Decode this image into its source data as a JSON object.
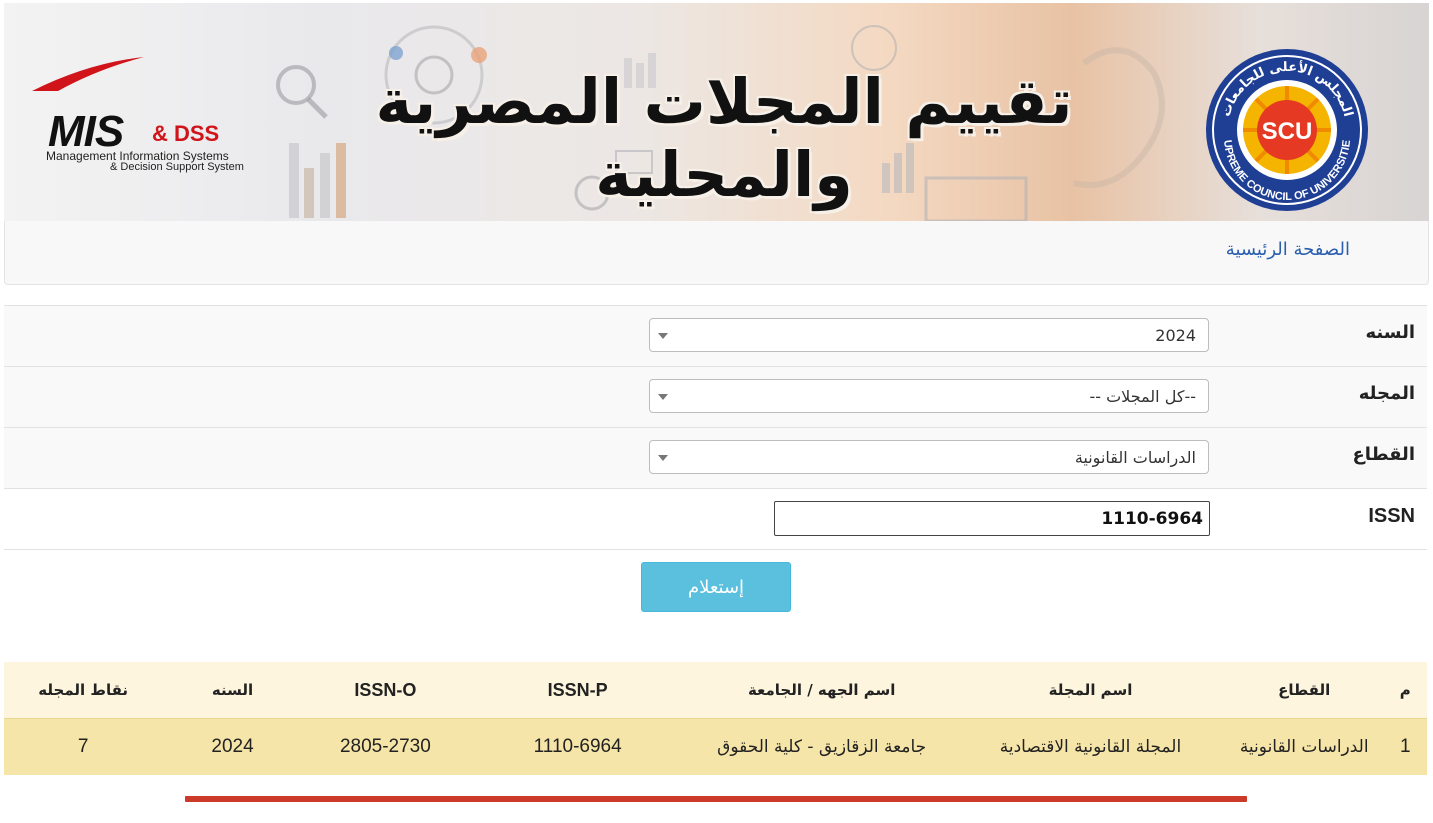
{
  "banner": {
    "title": "تقييم المجلات المصرية والمحلية",
    "left_logo": {
      "main": "MIS",
      "accent": "& DSS",
      "line1": "Management Information Systems",
      "line2": "& Decision Support System"
    },
    "right_logo": {
      "center": "SCU",
      "arc_top": "المجلس الأعلى للجامعات",
      "arc_bottom": "SUPREME COUNCIL OF UNIVERSITIES"
    }
  },
  "nav": {
    "home_label": "الصفحة الرئيسية"
  },
  "form": {
    "year": {
      "label": "السنه",
      "value": "2024"
    },
    "journal": {
      "label": "المجله",
      "value": "--كل المجلات --"
    },
    "sector": {
      "label": "القطاع",
      "value": "الدراسات القانونية"
    },
    "issn": {
      "label": "ISSN",
      "value": "1110-6964"
    },
    "submit_label": "إستعلام"
  },
  "table": {
    "headers": [
      "م",
      "القطاع",
      "اسم المجلة",
      "اسم الجهه / الجامعة",
      "ISSN-P",
      "ISSN-O",
      "السنه",
      "نقاط المجله"
    ],
    "rows": [
      [
        "1",
        "الدراسات القانونية",
        "المجلة القانونية الاقتصادية",
        "جامعة الزقازيق - كلية الحقوق",
        "1110-6964",
        "2805-2730",
        "2024",
        "7"
      ]
    ]
  },
  "colors": {
    "accent_button": "#5bc0de",
    "table_header": "#fdf5de",
    "table_row": "#f6e5a8",
    "divider": "#cc3a2a",
    "link": "#2a5fb0"
  }
}
